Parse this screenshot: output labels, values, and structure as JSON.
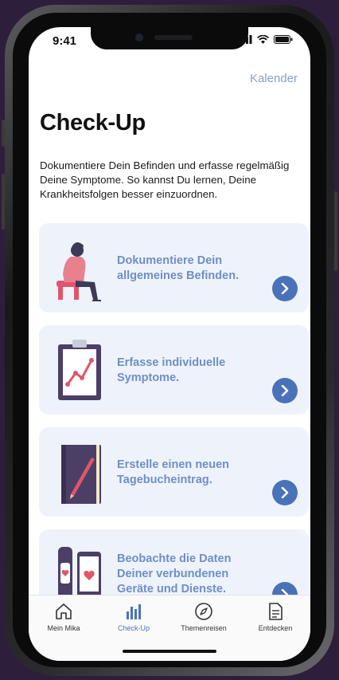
{
  "status_bar": {
    "time": "9:41"
  },
  "header": {
    "calendar_link": "Kalender",
    "title": "Check-Up"
  },
  "intro_text": "Dokumentiere Dein Befinden und erfasse regelmäßig Deine Symptome. So kannst Du lernen, Deine Krankheitsfolgen besser einzuordnen.",
  "cards": [
    {
      "label": "Dokumentiere Dein allgemeines Befinden.",
      "icon": "person-sitting-illustration"
    },
    {
      "label": "Erfasse individuelle Symptome.",
      "icon": "clipboard-chart-illustration"
    },
    {
      "label": "Erstelle einen neuen Tagebucheintrag.",
      "icon": "notebook-pen-illustration"
    },
    {
      "label": "Beobachte die Daten Deiner verbundenen Geräte und Dienste.",
      "icon": "devices-heart-illustration"
    }
  ],
  "tabbar": {
    "items": [
      {
        "label": "Mein Mika",
        "icon": "home-icon"
      },
      {
        "label": "Check-Up",
        "icon": "bar-chart-icon",
        "active": true
      },
      {
        "label": "Themenreisen",
        "icon": "compass-icon"
      },
      {
        "label": "Entdecken",
        "icon": "document-icon"
      }
    ]
  },
  "colors": {
    "accent": "#4a72b8",
    "card_text": "#6f8fc3",
    "card_bg": "#eef3fb",
    "link": "#8aa0c8"
  }
}
